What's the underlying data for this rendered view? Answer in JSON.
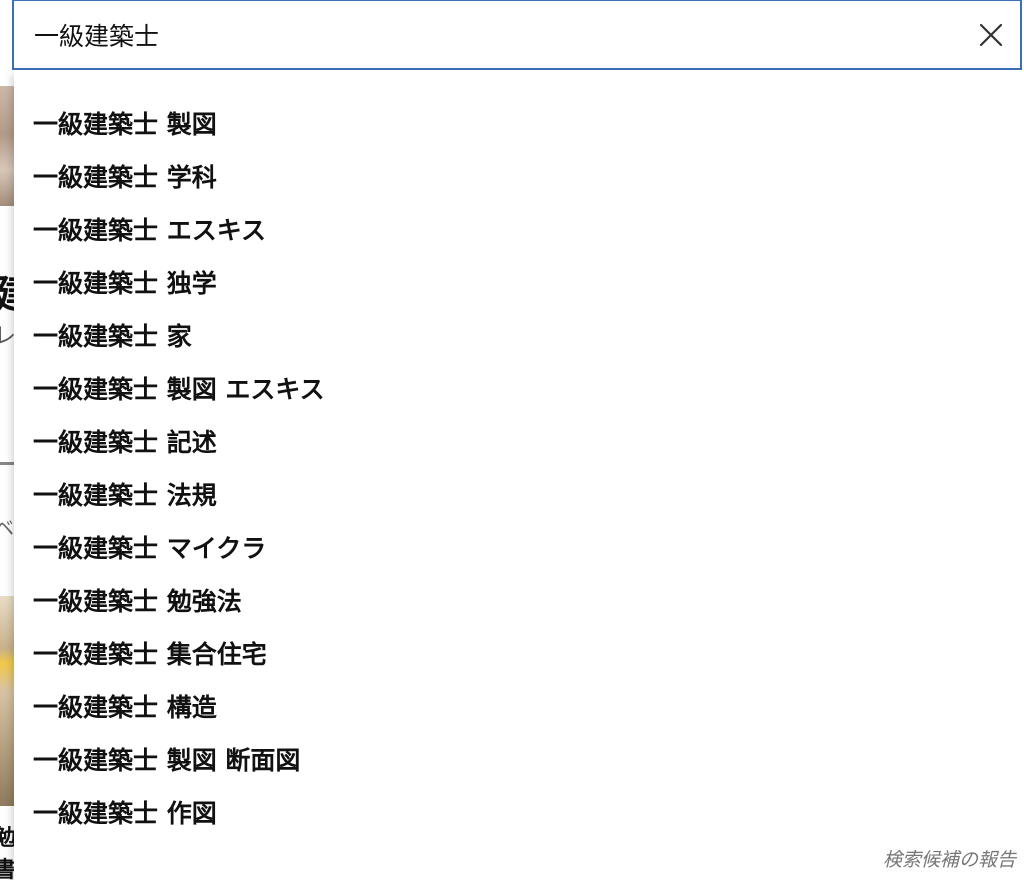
{
  "search": {
    "value": "一級建築士"
  },
  "suggestions": [
    {
      "label": "一級建築士 製図"
    },
    {
      "label": "一級建築士 学科"
    },
    {
      "label": "一級建築士 エスキス"
    },
    {
      "label": "一級建築士 独学"
    },
    {
      "label": "一級建築士 家"
    },
    {
      "label": "一級建築士 製図 エスキス"
    },
    {
      "label": "一級建築士 記述"
    },
    {
      "label": "一級建築士 法規"
    },
    {
      "label": "一級建築士 マイクラ"
    },
    {
      "label": "一級建築士 勉強法"
    },
    {
      "label": "一級建築士 集合住宅"
    },
    {
      "label": "一級建築士 構造"
    },
    {
      "label": "一級建築士 製図 断面図"
    },
    {
      "label": "一級建築士 作図"
    }
  ],
  "report_link": "検索候補の報告",
  "colors": {
    "input_border": "#3d6fb8",
    "suggestion_text": "#111111",
    "report_text": "#777777"
  },
  "icons": {
    "clear": "close-icon"
  }
}
